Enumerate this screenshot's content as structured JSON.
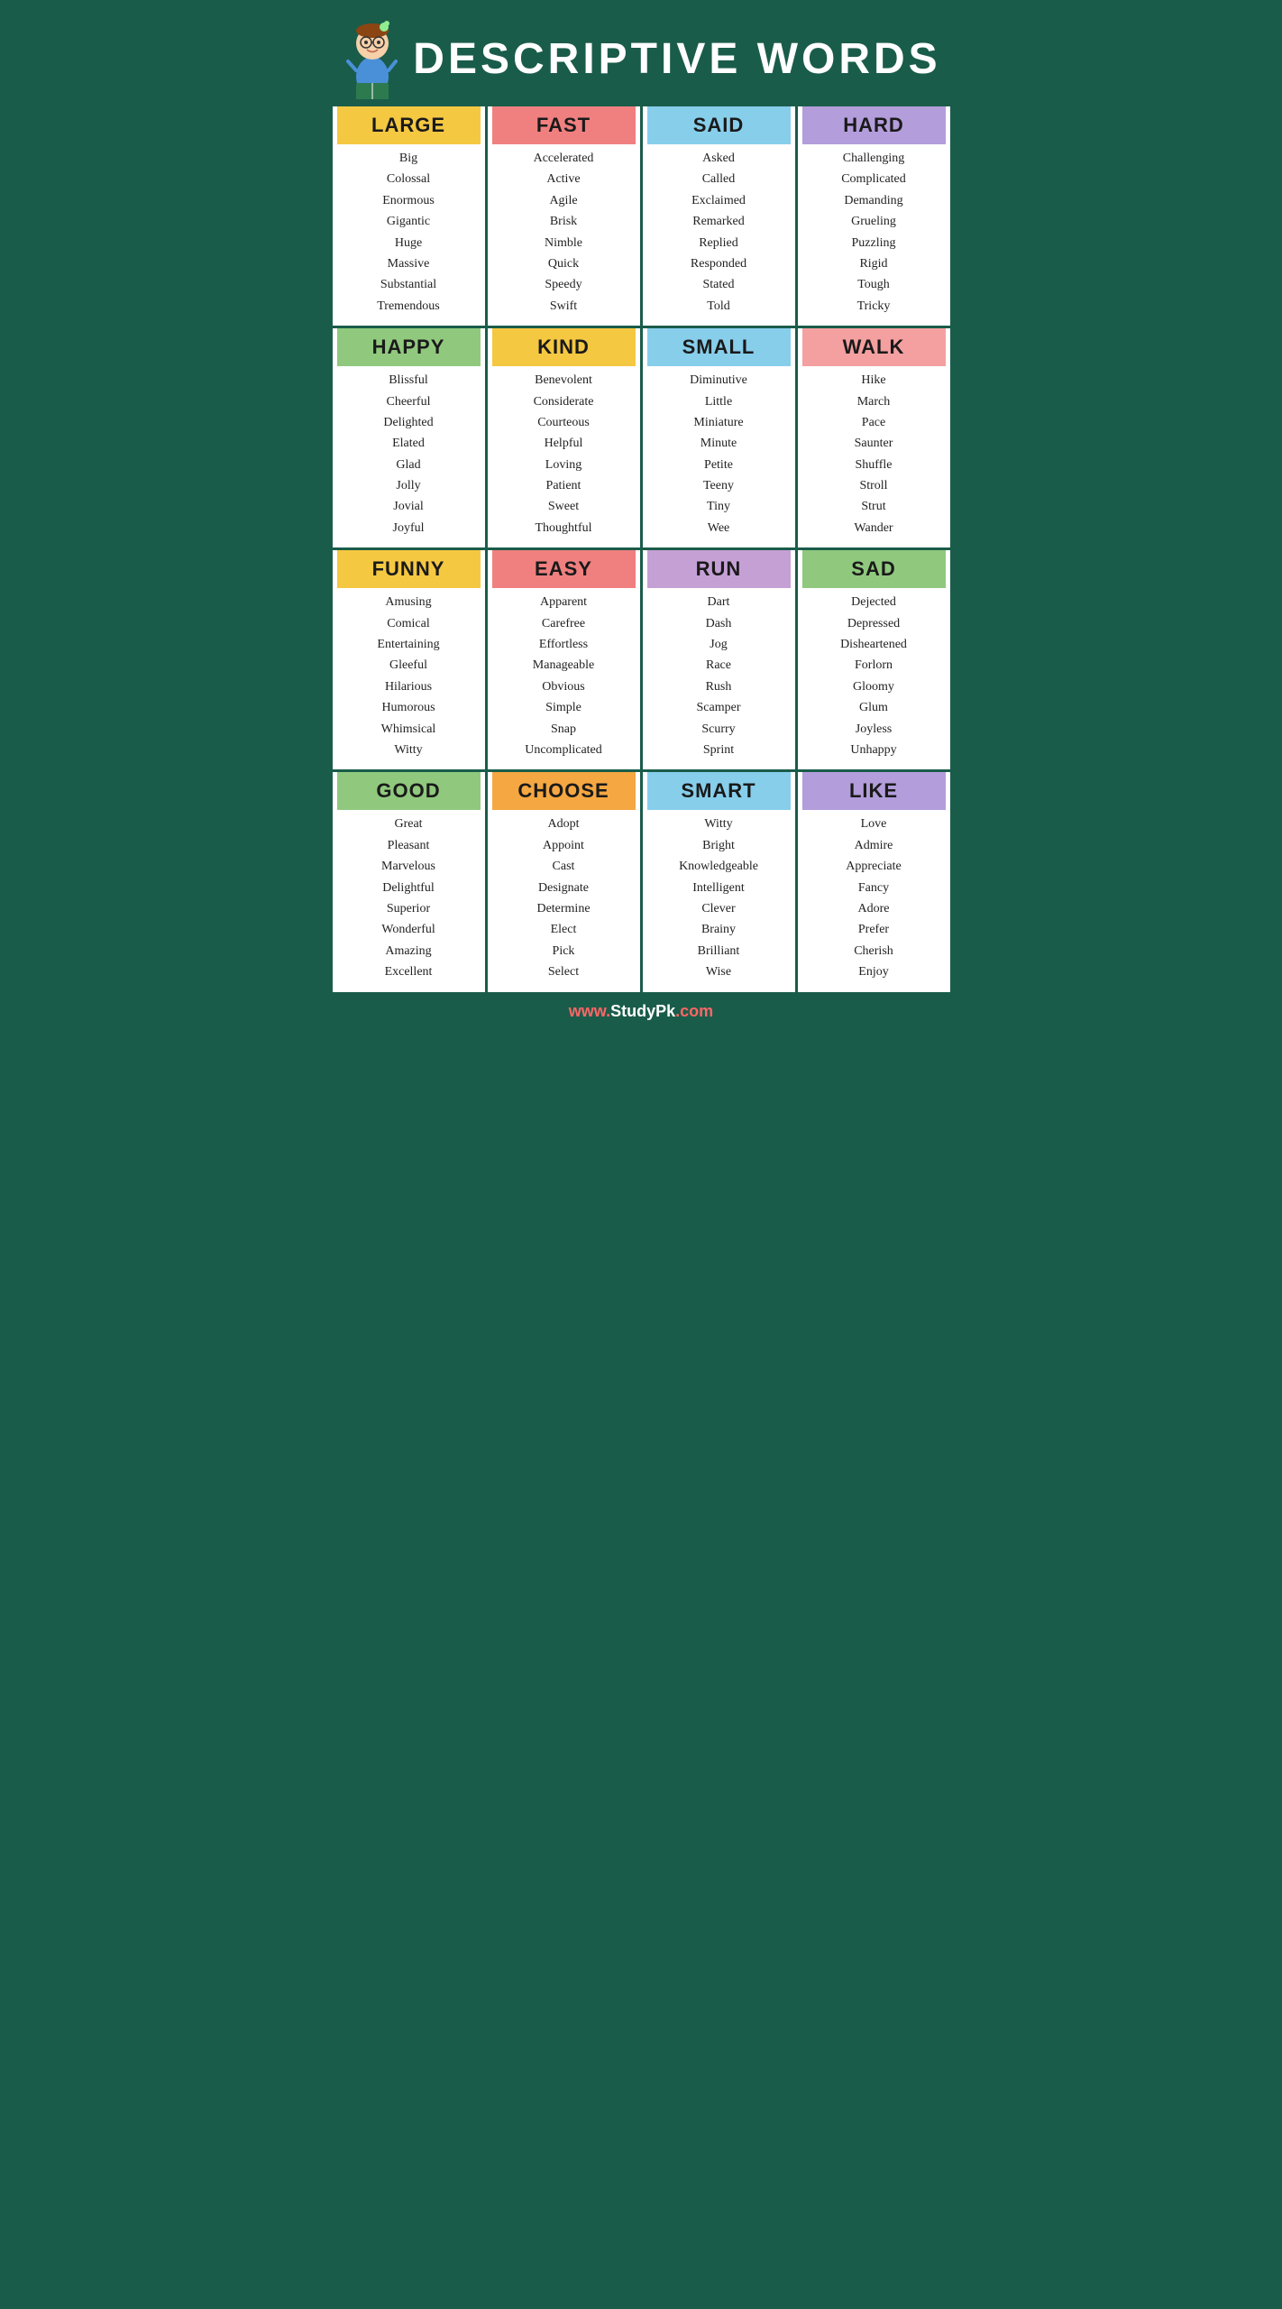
{
  "title": "DESCRIPTIVE WORDS",
  "footer": "www.StudyPk.com",
  "categories": [
    {
      "id": "large",
      "header": "LARGE",
      "headerBg": "bg-yellow",
      "words": [
        "Big",
        "Colossal",
        "Enormous",
        "Gigantic",
        "Huge",
        "Massive",
        "Substantial",
        "Tremendous"
      ]
    },
    {
      "id": "fast",
      "header": "FAST",
      "headerBg": "bg-pink",
      "words": [
        "Accelerated",
        "Active",
        "Agile",
        "Brisk",
        "Nimble",
        "Quick",
        "Speedy",
        "Swift"
      ]
    },
    {
      "id": "said",
      "header": "SAID",
      "headerBg": "bg-blue",
      "words": [
        "Asked",
        "Called",
        "Exclaimed",
        "Remarked",
        "Replied",
        "Responded",
        "Stated",
        "Told"
      ]
    },
    {
      "id": "hard",
      "header": "HARD",
      "headerBg": "bg-purple",
      "words": [
        "Challenging",
        "Complicated",
        "Demanding",
        "Grueling",
        "Puzzling",
        "Rigid",
        "Tough",
        "Tricky"
      ]
    },
    {
      "id": "happy",
      "header": "HAPPY",
      "headerBg": "bg-green",
      "words": [
        "Blissful",
        "Cheerful",
        "Delighted",
        "Elated",
        "Glad",
        "Jolly",
        "Jovial",
        "Joyful"
      ]
    },
    {
      "id": "kind",
      "header": "KIND",
      "headerBg": "bg-yellow",
      "words": [
        "Benevolent",
        "Considerate",
        "Courteous",
        "Helpful",
        "Loving",
        "Patient",
        "Sweet",
        "Thoughtful"
      ]
    },
    {
      "id": "small",
      "header": "SMALL",
      "headerBg": "bg-blue",
      "words": [
        "Diminutive",
        "Little",
        "Miniature",
        "Minute",
        "Petite",
        "Teeny",
        "Tiny",
        "Wee"
      ]
    },
    {
      "id": "walk",
      "header": "WALK",
      "headerBg": "bg-salmon",
      "words": [
        "Hike",
        "March",
        "Pace",
        "Saunter",
        "Shuffle",
        "Stroll",
        "Strut",
        "Wander"
      ]
    },
    {
      "id": "funny",
      "header": "FUNNY",
      "headerBg": "bg-yellow",
      "words": [
        "Amusing",
        "Comical",
        "Entertaining",
        "Gleeful",
        "Hilarious",
        "Humorous",
        "Whimsical",
        "Witty"
      ]
    },
    {
      "id": "easy",
      "header": "EASY",
      "headerBg": "bg-pink",
      "words": [
        "Apparent",
        "Carefree",
        "Effortless",
        "Manageable",
        "Obvious",
        "Simple",
        "Snap",
        "Uncomplicated"
      ]
    },
    {
      "id": "run",
      "header": "RUN",
      "headerBg": "bg-lavender",
      "words": [
        "Dart",
        "Dash",
        "Jog",
        "Race",
        "Rush",
        "Scamper",
        "Scurry",
        "Sprint"
      ]
    },
    {
      "id": "sad",
      "header": "SAD",
      "headerBg": "bg-green",
      "words": [
        "Dejected",
        "Depressed",
        "Disheartened",
        "Forlorn",
        "Gloomy",
        "Glum",
        "Joyless",
        "Unhappy"
      ]
    },
    {
      "id": "good",
      "header": "GOOD",
      "headerBg": "bg-green",
      "words": [
        "Great",
        "Pleasant",
        "Marvelous",
        "Delightful",
        "Superior",
        "Wonderful",
        "Amazing",
        "Excellent"
      ]
    },
    {
      "id": "choose",
      "header": "CHOOSE",
      "headerBg": "bg-orange",
      "words": [
        "Adopt",
        "Appoint",
        "Cast",
        "Designate",
        "Determine",
        "Elect",
        "Pick",
        "Select"
      ]
    },
    {
      "id": "smart",
      "header": "SMART",
      "headerBg": "bg-blue",
      "words": [
        "Witty",
        "Bright",
        "Knowledgeable",
        "Intelligent",
        "Clever",
        "Brainy",
        "Brilliant",
        "Wise"
      ]
    },
    {
      "id": "like",
      "header": "LIKE",
      "headerBg": "bg-purple",
      "words": [
        "Love",
        "Admire",
        "Appreciate",
        "Fancy",
        "Adore",
        "Prefer",
        "Cherish",
        "Enjoy"
      ]
    }
  ]
}
